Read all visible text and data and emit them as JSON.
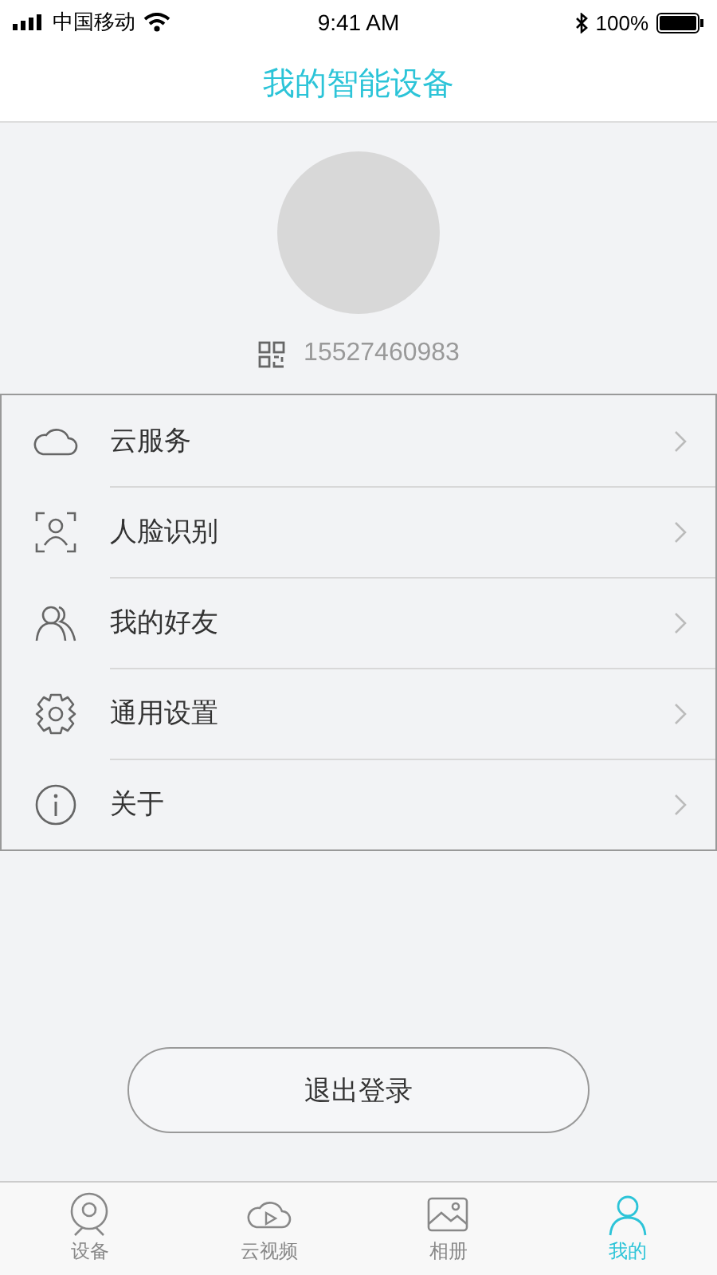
{
  "status_bar": {
    "carrier": "中国移动",
    "time": "9:41 AM",
    "battery": "100%"
  },
  "header": {
    "title": "我的智能设备"
  },
  "profile": {
    "phone": "15527460983"
  },
  "menu": [
    {
      "kind": "cloud",
      "label": "云服务"
    },
    {
      "kind": "face",
      "label": "人脸识别"
    },
    {
      "kind": "friends",
      "label": "我的好友"
    },
    {
      "kind": "settings",
      "label": "通用设置"
    },
    {
      "kind": "about",
      "label": "关于"
    }
  ],
  "logout": "退出登录",
  "tabs": [
    {
      "kind": "device",
      "label": "设备",
      "selected": false
    },
    {
      "kind": "video",
      "label": "云视频",
      "selected": false
    },
    {
      "kind": "album",
      "label": "相册",
      "selected": false
    },
    {
      "kind": "me",
      "label": "我的",
      "selected": true
    }
  ]
}
